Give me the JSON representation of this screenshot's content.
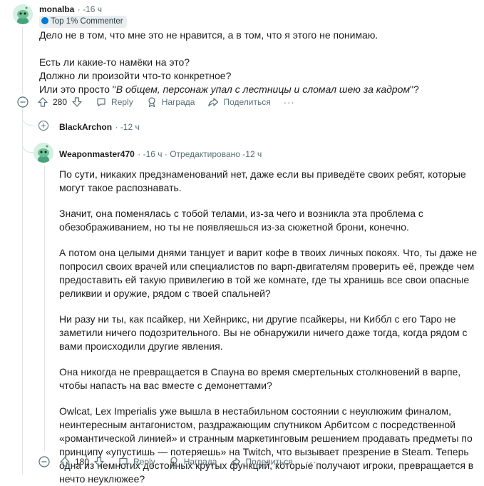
{
  "comment1": {
    "username": "monalba",
    "time": "· -16 ч",
    "flair": "Top 1% Commenter",
    "lines": [
      "Дело не в том, что мне это не нравится, а в том, что я этого не понимаю.",
      "Есть ли какие-то намёки на это?",
      "Должно ли произойти что-то конкретное?"
    ],
    "last_line_prefix": "Или это просто \"",
    "last_line_italic": "В общем, персонаж упал с лестницы и сломал шею за кадром",
    "last_line_suffix": "\"?",
    "votes": "280",
    "reply": "Reply",
    "award": "Награда",
    "share": "Поделиться",
    "more": "···"
  },
  "collapsed": {
    "username": "BlackArchon",
    "time": "· -12 ч",
    "expand": "+"
  },
  "comment2": {
    "username": "Weaponmaster470",
    "time": "· -16 ч · Отредактировано -12 ч",
    "paragraphs": [
      "По сути, никаких предзнаменований нет, даже если вы приведёте своих ребят, которые могут такое распознавать.",
      "Значит, она поменялась с тобой телами, из-за чего и возникла эта проблема с обезображиванием, но ты не появляешься из-за сюжетной брони, конечно.",
      "А потом она целыми днями танцует и варит кофе в твоих личных покоях. Что, ты даже не попросил своих врачей или специалистов по варп-двигателям проверить её, прежде чем предоставить ей такую привилегию в той же комнате, где ты хранишь все свои опасные реликвии и оружие, рядом с твоей спальней?",
      "Ни разу ни ты, как псайкер, ни Хейнрикс, ни другие псайкеры, ни Киббл с его Таро не заметили ничего подозрительного. Вы не обнаружили ничего даже тогда, когда рядом с вами происходили другие явления.",
      "Она никогда не превращается в Спауна во время смертельных столкновений в варпе, чтобы напасть на вас вместе с демонеттами?",
      "Owlcat, Lex Imperialis уже вышла в нестабильном состоянии с неуклюжим финалом, неинтересным антагонистом, раздражающим спутником Арбитсом с посредственной «романтической линией» и странным маркетинговым решением продавать предметы по принципу «упустишь — потеряешь» на Twitch, что вызывает презрение в Steam. Теперь одна из немногих достойных крутых функций, которые получают игроки, превращается в нечто неуклюжее?"
    ],
    "votes": "180",
    "reply": "Reply",
    "award": "Награда",
    "share": "Поделиться",
    "more": "···"
  },
  "colors": {
    "avatar_bg": "#d7efe2",
    "snoo": "#46a27a",
    "meta": "#576f76",
    "flair_bg": "#eaedef"
  }
}
